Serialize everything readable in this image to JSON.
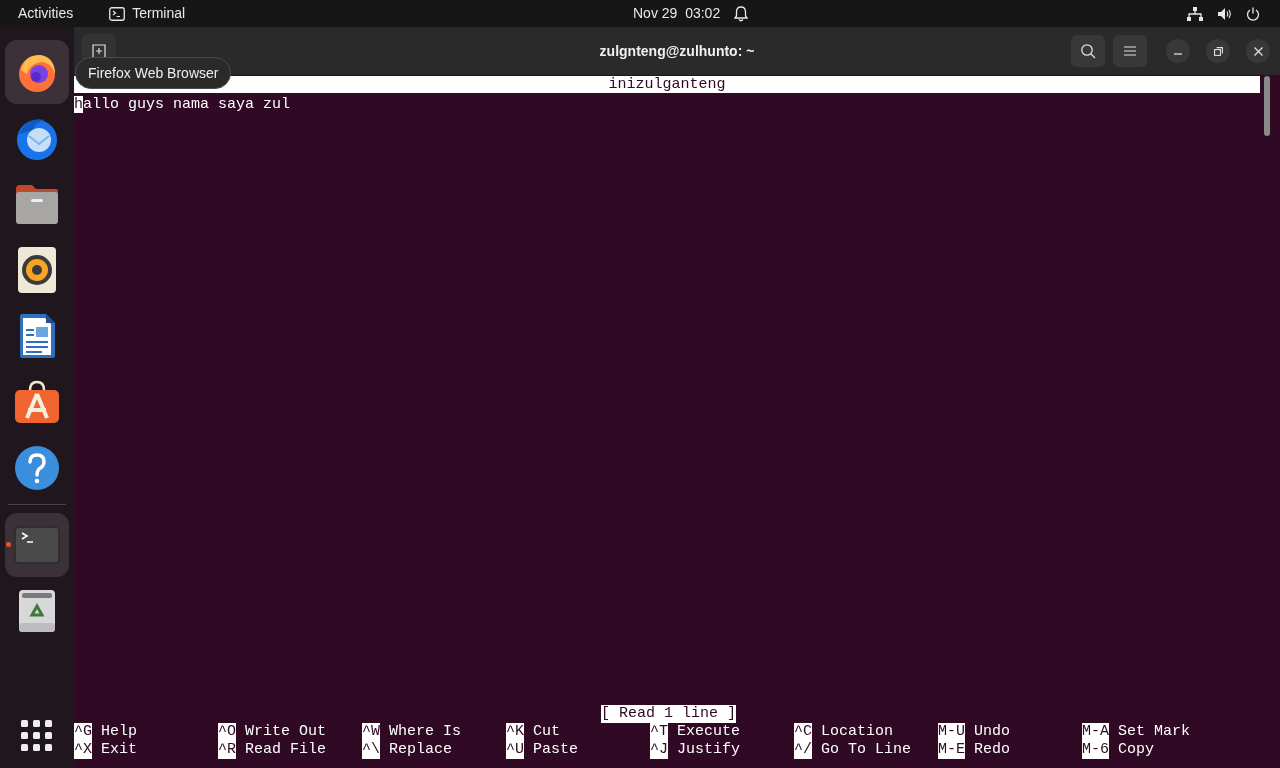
{
  "top_bar": {
    "activities": "Activities",
    "app_menu": "Terminal",
    "clock": "Nov 29  03:02"
  },
  "dock": {
    "items": [
      {
        "kind": "firefox",
        "highlighted": true,
        "running": false
      },
      {
        "kind": "thunderbird",
        "highlighted": false,
        "running": false
      },
      {
        "kind": "files",
        "highlighted": false,
        "running": false
      },
      {
        "kind": "rhythmbox",
        "highlighted": false,
        "running": false
      },
      {
        "kind": "writer",
        "highlighted": false,
        "running": false
      },
      {
        "kind": "appcenter",
        "highlighted": false,
        "running": false
      },
      {
        "kind": "help",
        "highlighted": false,
        "running": false
      },
      {
        "kind": "terminal",
        "highlighted": true,
        "running": true
      },
      {
        "kind": "trash",
        "highlighted": false,
        "running": false
      }
    ],
    "tooltip": "Firefox Web Browser"
  },
  "window": {
    "title": "zulgnteng@zulhunto: ~"
  },
  "nano": {
    "filename": "inizulganteng",
    "lines": [
      "hallo guys nama saya zul"
    ],
    "status": "[ Read 1 line ]",
    "shortcut_rows": [
      [
        {
          "key": "^G",
          "label": "Help"
        },
        {
          "key": "^O",
          "label": "Write Out"
        },
        {
          "key": "^W",
          "label": "Where Is"
        },
        {
          "key": "^K",
          "label": "Cut"
        },
        {
          "key": "^T",
          "label": "Execute"
        },
        {
          "key": "^C",
          "label": "Location"
        },
        {
          "key": "M-U",
          "label": "Undo"
        },
        {
          "key": "M-A",
          "label": "Set Mark"
        }
      ],
      [
        {
          "key": "^X",
          "label": "Exit"
        },
        {
          "key": "^R",
          "label": "Read File"
        },
        {
          "key": "^\\",
          "label": "Replace"
        },
        {
          "key": "^U",
          "label": "Paste"
        },
        {
          "key": "^J",
          "label": "Justify"
        },
        {
          "key": "^/",
          "label": "Go To Line"
        },
        {
          "key": "M-E",
          "label": "Redo"
        },
        {
          "key": "M-6",
          "label": "Copy"
        }
      ]
    ]
  }
}
